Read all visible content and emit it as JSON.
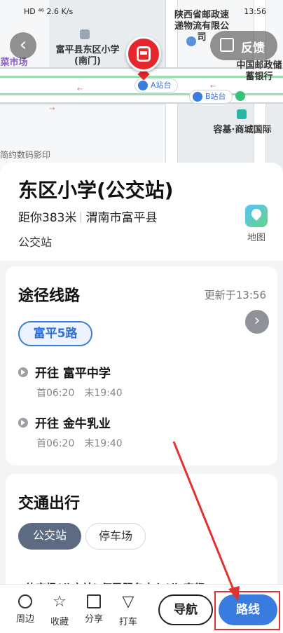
{
  "status_bar": {
    "left": "HD ⁴⁶ 2.6 K/s",
    "time": "13:56"
  },
  "map": {
    "pois": {
      "school": "富平县东区小学(南门)",
      "post_express": "陕西省邮政速递物流有限公司",
      "china_post": "中国邮政储蓄银行",
      "market": "菜市场",
      "commerce": "容基·商城国际",
      "cinema": "简约数码影印"
    },
    "stop_a": "A站台",
    "stop_b": "B站台"
  },
  "header": {
    "back_icon": "chevron-left-icon",
    "feedback_label": "反馈"
  },
  "station": {
    "title": "东区小学(公交站)",
    "distance": "距你383米",
    "location": "渭南市富平县",
    "type": "公交站",
    "map_label": "地图"
  },
  "routes": {
    "title": "途径线路",
    "updated": "更新于13:56",
    "line": "富平5路",
    "directions": [
      {
        "label": "开往 富平中学",
        "first": "首06:20",
        "last": "末19:40"
      },
      {
        "label": "开往 金牛乳业",
        "first": "首06:20",
        "last": "末19:40"
      }
    ]
  },
  "traffic": {
    "title": "交通出行",
    "tabs": [
      "公交站",
      "停车场"
    ],
    "list_preview": "体育场(公交站)      便民服务中心(公      南都"
  },
  "bottom_bar": {
    "tools": [
      {
        "label": "周边",
        "icon": "search-icon"
      },
      {
        "label": "收藏",
        "icon": "star-icon"
      },
      {
        "label": "分享",
        "icon": "share-icon"
      },
      {
        "label": "打车",
        "icon": "taxi-icon"
      }
    ],
    "nav_label": "导航",
    "route_label": "路线"
  },
  "colors": {
    "accent": "#3a7be0",
    "pin": "#e5262b",
    "annotation": "#e3312d"
  }
}
